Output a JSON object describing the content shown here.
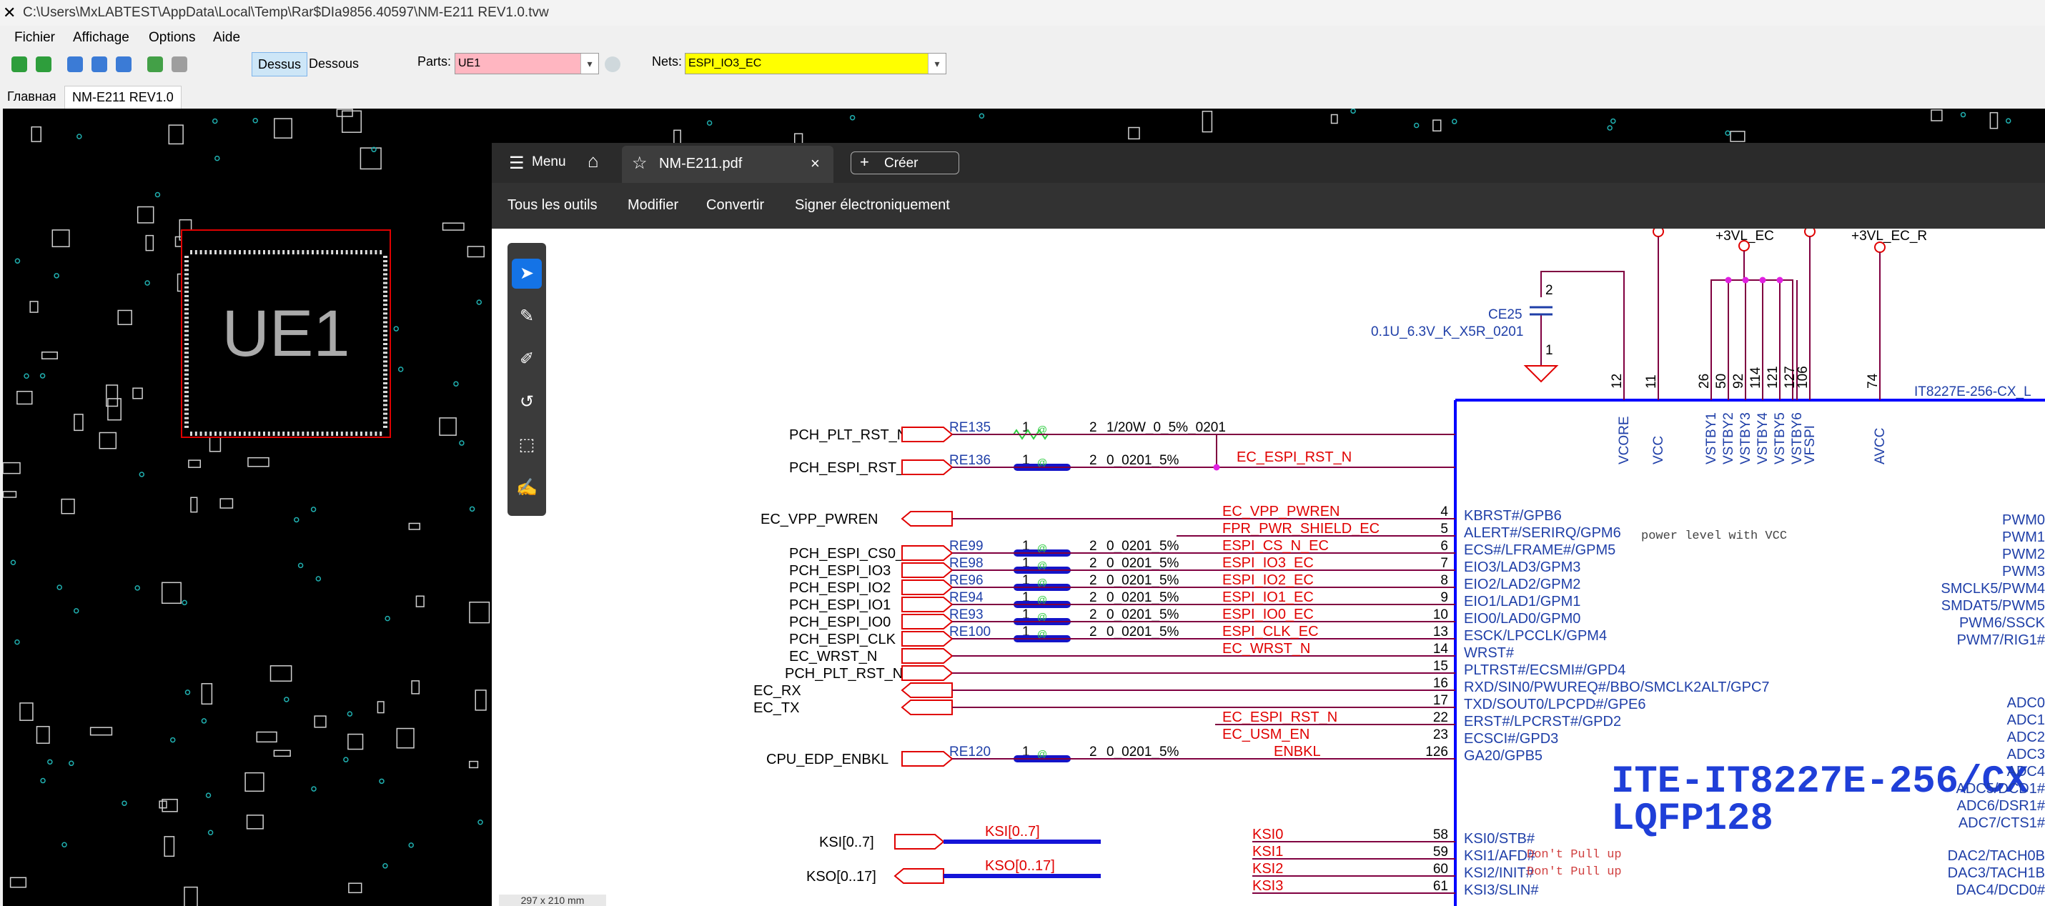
{
  "titlebar": {
    "title": "C:\\Users\\MxLABTEST\\AppData\\Local\\Temp\\Rar$DIa9856.40597\\NM-E211 REV1.0.tvw"
  },
  "menu": {
    "items": [
      "Fichier",
      "Affichage",
      "Options",
      "Aide"
    ]
  },
  "toolbar": {
    "dessus_label": "Dessus",
    "dessous_label": "Dessous",
    "parts_label": "Parts:",
    "parts_value": "UE1",
    "nets_label": "Nets:",
    "nets_value": "ESPI_IO3_EC"
  },
  "tabs": [
    "Главная",
    "NM-E211 REV1.0"
  ],
  "board": {
    "component_label": "UE1"
  },
  "pdf": {
    "menu_label": "Menu",
    "tab_title": "NM-E211.pdf",
    "create_label": "Créer",
    "tools": [
      "Tous les outils",
      "Modifier",
      "Convertir",
      "Signer électroniquement"
    ],
    "page_size": "297 x 210 mm"
  },
  "schematic": {
    "cap_ref": "CE25",
    "cap_value": "0.1U_6.3V_K_X5R_0201",
    "cap_pins": [
      "2",
      "1"
    ],
    "power_labels": [
      "+3VL_EC",
      "+3VL_EC_R"
    ],
    "top_pins": [
      {
        "num": "12",
        "name": "VCORE"
      },
      {
        "num": "11",
        "name": "VCC"
      },
      {
        "num": "26",
        "name": "VSTBY1"
      },
      {
        "num": "50",
        "name": "VSTBY2"
      },
      {
        "num": "92",
        "name": "VSTBY3"
      },
      {
        "num": "114",
        "name": "VSTBY4"
      },
      {
        "num": "121",
        "name": "VSTBY5"
      },
      {
        "num": "127",
        "name": "VSTBY6"
      },
      {
        "num": "106",
        "name": "VFSPI"
      },
      {
        "num": "74",
        "name": "AVCC"
      }
    ],
    "chip_ref": "IT8227E-256-CX_L",
    "chip_title_1": "ITE-IT8227E-256/CX",
    "chip_title_2": "LQFP128",
    "left_ports": [
      {
        "name": "PCH_PLT_RST_N",
        "ref": "RE135",
        "value": "1/20W_0_5%_0201",
        "p1": "1",
        "p2": "2"
      },
      {
        "name": "PCH_ESPI_RST_N",
        "ref": "RE136",
        "value": "0_0201_5%",
        "p1": "1",
        "p2": "2"
      },
      {
        "name": "EC_VPP_PWREN"
      },
      {
        "name": "PCH_ESPI_CS0_N",
        "ref": "RE99",
        "value": "0_0201_5%",
        "p1": "1",
        "p2": "2"
      },
      {
        "name": "PCH_ESPI_IO3",
        "ref": "RE98",
        "value": "0_0201_5%",
        "p1": "1",
        "p2": "2"
      },
      {
        "name": "PCH_ESPI_IO2",
        "ref": "RE96",
        "value": "0_0201_5%",
        "p1": "1",
        "p2": "2"
      },
      {
        "name": "PCH_ESPI_IO1",
        "ref": "RE94",
        "value": "0_0201_5%",
        "p1": "1",
        "p2": "2"
      },
      {
        "name": "PCH_ESPI_IO0",
        "ref": "RE93",
        "value": "0_0201_5%",
        "p1": "1",
        "p2": "2"
      },
      {
        "name": "PCH_ESPI_CLK",
        "ref": "RE100",
        "value": "0_0201_5%",
        "p1": "1",
        "p2": "2"
      },
      {
        "name": "EC_WRST_N"
      },
      {
        "name": "PCH_PLT_RST_N"
      },
      {
        "name": "EC_RX"
      },
      {
        "name": "EC_TX"
      },
      {
        "name": "CPU_EDP_ENBKL",
        "ref": "RE120",
        "value": "0_0201_5%",
        "p1": "1",
        "p2": "2"
      }
    ],
    "nets": [
      {
        "net": "EC_ESPI_RST_N"
      },
      {
        "net": "EC_VPP_PWREN",
        "num": "4",
        "pin": "KBRST#/GPB6"
      },
      {
        "net": "FPR_PWR_SHIELD_EC",
        "num": "5",
        "pin": "ALERT#/SERIRQ/GPM6"
      },
      {
        "net": "ESPI_CS_N_EC",
        "num": "6",
        "pin": "ECS#/LFRAME#/GPM5"
      },
      {
        "net": "ESPI_IO3_EC",
        "num": "7",
        "pin": "EIO3/LAD3/GPM3"
      },
      {
        "net": "ESPI_IO2_EC",
        "num": "8",
        "pin": "EIO2/LAD2/GPM2"
      },
      {
        "net": "ESPI_IO1_EC",
        "num": "9",
        "pin": "EIO1/LAD1/GPM1"
      },
      {
        "net": "ESPI_IO0_EC",
        "num": "10",
        "pin": "EIO0/LAD0/GPM0"
      },
      {
        "net": "ESPI_CLK_EC",
        "num": "13",
        "pin": "ESCK/LPCCLK/GPM4"
      },
      {
        "net": "EC_WRST_N",
        "num": "14",
        "pin": "WRST#"
      },
      {
        "net": "",
        "num": "15",
        "pin": "PLTRST#/ECSMI#/GPD4"
      },
      {
        "net": "",
        "num": "16",
        "pin": "RXD/SIN0/PWUREQ#/BBO/SMCLK2ALT/GPC7"
      },
      {
        "net": "",
        "num": "17",
        "pin": "TXD/SOUT0/LPCPD#/GPE6"
      },
      {
        "net": "EC_ESPI_RST_N",
        "num": "22",
        "pin": "ERST#/LPCRST#/GPD2"
      },
      {
        "net": "EC_USM_EN",
        "num": "23",
        "pin": "ECSCI#/GPD3"
      },
      {
        "net": "ENBKL",
        "num": "126",
        "pin": "GA20/GPB5"
      }
    ],
    "power_note": "power  level with VCC",
    "bus_ports": [
      {
        "name": "KSI[0..7]",
        "bus": "KSI[0..7]"
      },
      {
        "name": "KSO[0..17]",
        "bus": "KSO[0..17]"
      }
    ],
    "ksi": [
      {
        "net": "KSI0",
        "num": "58",
        "pin": "KSI0/STB#"
      },
      {
        "net": "KSI1",
        "num": "59",
        "pin": "KSI1/AFD#"
      },
      {
        "net": "KSI2",
        "num": "60",
        "pin": "KSI2/INIT#"
      },
      {
        "net": "KSI3",
        "num": "61",
        "pin": "KSI3/SLIN#"
      }
    ],
    "pullup_note": "Don't Pull up",
    "right_pins": [
      "PWM0",
      "PWM1",
      "PWM2",
      "PWM3",
      "SMCLK5/PWM4",
      "SMDAT5/PWM5",
      "PWM6/SSCK",
      "PWM7/RIG1#"
    ],
    "adc_pins": [
      "ADC0",
      "ADC1",
      "ADC2",
      "ADC3",
      "ADC4",
      "ADC5/DCD1#",
      "ADC6/DSR1#",
      "ADC7/CTS1#"
    ],
    "dac_pins": [
      "DAC2/TACH0B",
      "DAC3/TACH1B",
      "DAC4/DCD0#"
    ]
  },
  "colors": {
    "pin_blue": "#1f3fa8",
    "chip_outline": "#0000ff",
    "net_red": "#e00000",
    "wire": "#800040",
    "highlight_yellow": "#ffff00",
    "parts_pink": "#ffb6c1",
    "pdf_dark": "#2b2b2b"
  }
}
